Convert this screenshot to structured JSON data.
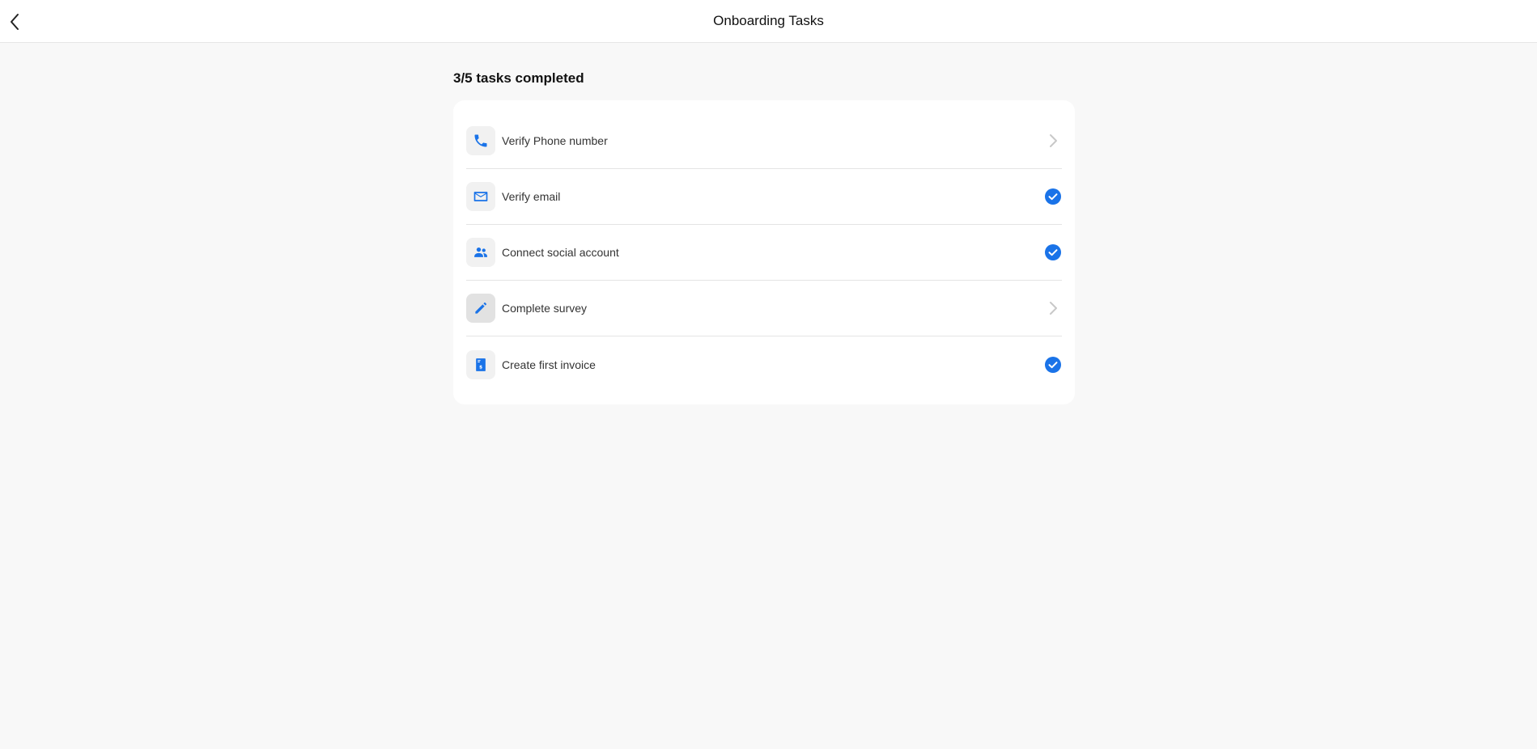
{
  "header": {
    "title": "Onboarding Tasks"
  },
  "progress": {
    "label": "3/5 tasks completed",
    "completed": 3,
    "total": 5
  },
  "tasks": [
    {
      "label": "Verify Phone number",
      "icon": "phone-icon",
      "status": "pending"
    },
    {
      "label": "Verify email",
      "icon": "email-icon",
      "status": "completed"
    },
    {
      "label": "Connect social account",
      "icon": "people-icon",
      "status": "completed"
    },
    {
      "label": "Complete survey",
      "icon": "pencil-icon",
      "status": "pending"
    },
    {
      "label": "Create first invoice",
      "icon": "invoice-icon",
      "status": "completed"
    }
  ],
  "colors": {
    "accent": "#1a73e8",
    "chevron": "#c8c8c8",
    "background": "#f8f8f8"
  }
}
